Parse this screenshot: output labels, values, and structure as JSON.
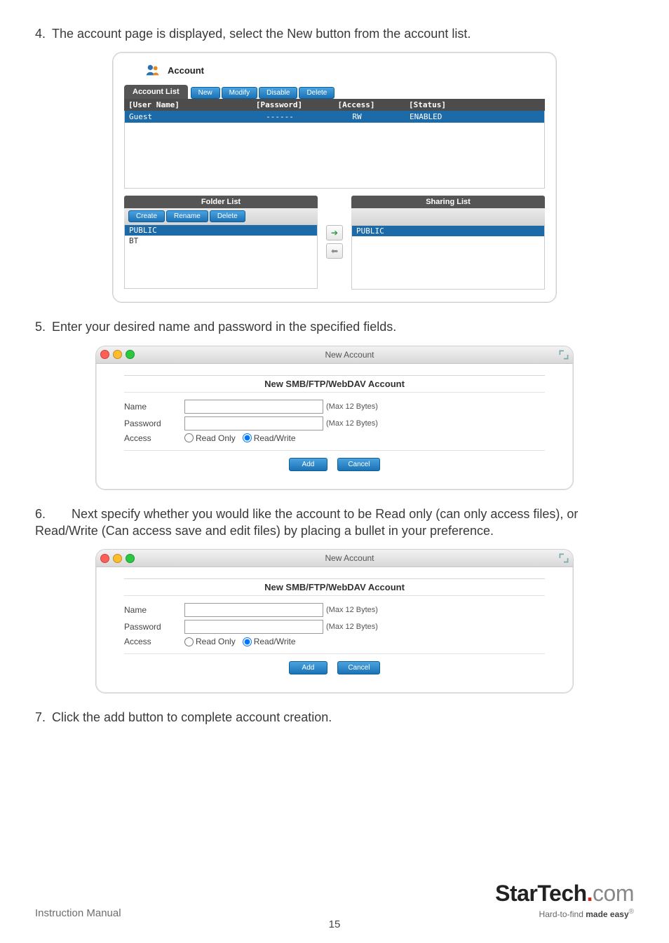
{
  "steps": {
    "s4": {
      "num": "4.",
      "text": "The account page is displayed, select the New button from the account list."
    },
    "s5": {
      "num": "5.",
      "text": "Enter your desired name and password in the specified fields."
    },
    "s6": {
      "num": "6.",
      "text": "Next specify whether you would like the account to be Read only (can only access files), or Read/Write (Can access save and edit files) by placing a bullet in your preference."
    },
    "s7": {
      "num": "7.",
      "text": "Click the add button to complete account creation."
    }
  },
  "accountPanel": {
    "title": "Account",
    "tabLabel": "Account List",
    "buttons": {
      "new": "New",
      "modify": "Modify",
      "disable": "Disable",
      "delete": "Delete"
    },
    "columns": {
      "user": "[User Name]",
      "pass": "[Password]",
      "access": "[Access]",
      "status": "[Status]"
    },
    "rows": [
      {
        "user": "Guest",
        "pass": "------",
        "access": "RW",
        "status": "ENABLED"
      }
    ],
    "folderList": {
      "label": "Folder List",
      "buttons": {
        "create": "Create",
        "rename": "Rename",
        "delete": "Delete"
      },
      "items": [
        "PUBLIC",
        "BT"
      ]
    },
    "sharingList": {
      "label": "Sharing List",
      "items": [
        "PUBLIC"
      ]
    }
  },
  "dialog": {
    "windowTitle": "New Account",
    "heading": "New SMB/FTP/WebDAV Account",
    "labels": {
      "name": "Name",
      "password": "Password",
      "access": "Access"
    },
    "hints": {
      "max": "(Max 12 Bytes)"
    },
    "radios": {
      "ro": "Read Only",
      "rw": "Read/Write"
    },
    "buttons": {
      "add": "Add",
      "cancel": "Cancel"
    }
  },
  "footer": {
    "instruction": "Instruction Manual",
    "page": "15",
    "brand": "StarTech",
    "brandSuffix": "com",
    "tagline1": "Hard-to-find ",
    "tagline2": "made easy"
  }
}
